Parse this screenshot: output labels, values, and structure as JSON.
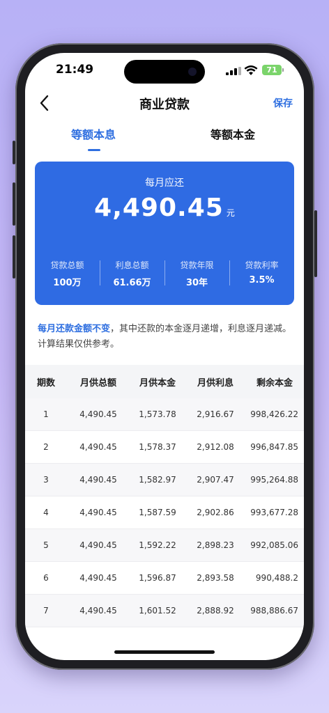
{
  "status": {
    "time": "21:49",
    "battery": "71"
  },
  "nav": {
    "title": "商业贷款",
    "save_label": "保存"
  },
  "tabs": [
    {
      "label": "等额本息"
    },
    {
      "label": "等额本金"
    }
  ],
  "summary": {
    "label": "每月应还",
    "amount": "4,490.45",
    "unit": "元",
    "stats": [
      {
        "label": "贷款总额",
        "value": "100万"
      },
      {
        "label": "利息总额",
        "value": "61.66万"
      },
      {
        "label": "贷款年限",
        "value": "30年"
      },
      {
        "label": "贷款利率",
        "value": "3.5%"
      }
    ]
  },
  "description": {
    "highlight": "每月还款金额不变",
    "text": "，其中还款的本金逐月递增，利息逐月递减。计算结果仅供参考。"
  },
  "table": {
    "headers": [
      "期数",
      "月供总额",
      "月供本金",
      "月供利息",
      "剩余本金"
    ],
    "rows": [
      [
        "1",
        "4,490.45",
        "1,573.78",
        "2,916.67",
        "998,426.22"
      ],
      [
        "2",
        "4,490.45",
        "1,578.37",
        "2,912.08",
        "996,847.85"
      ],
      [
        "3",
        "4,490.45",
        "1,582.97",
        "2,907.47",
        "995,264.88"
      ],
      [
        "4",
        "4,490.45",
        "1,587.59",
        "2,902.86",
        "993,677.28"
      ],
      [
        "5",
        "4,490.45",
        "1,592.22",
        "2,898.23",
        "992,085.06"
      ],
      [
        "6",
        "4,490.45",
        "1,596.87",
        "2,893.58",
        "990,488.2"
      ],
      [
        "7",
        "4,490.45",
        "1,601.52",
        "2,888.92",
        "988,886.67"
      ]
    ]
  },
  "colors": {
    "accent": "#2f6fe0",
    "card": "#2f6be3"
  }
}
